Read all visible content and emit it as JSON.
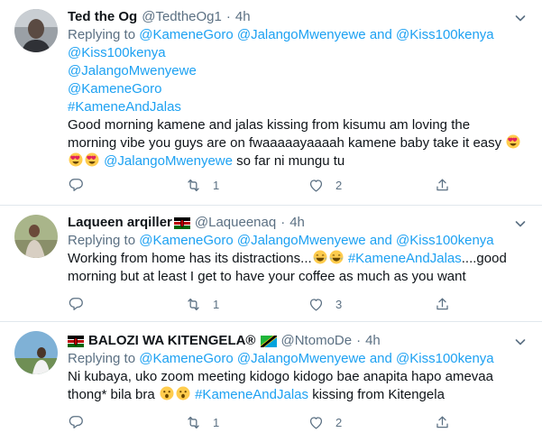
{
  "tweets": [
    {
      "name": "Ted the Og",
      "handle": "@TedtheOg1",
      "dot": "·",
      "time": "4h",
      "replying_prefix": "Replying to",
      "replying_handles": [
        "@KameneGoro",
        "@JalangoMwenyewe"
      ],
      "and_word": "and",
      "replying_last": "@Kiss100kenya",
      "tags": [
        "@Kiss100kenya",
        "@JalangoMwenyewe",
        "@KameneGoro",
        "#KameneAndJalas"
      ],
      "body_line1": "Good morning kamene and jalas kissing from kisumu  am loving the",
      "body_line2": "morning vibe  you guys are on fwaaaaayaaaah kamene baby take it easy",
      "body_line3_mention": "@JalangoMwenyewe",
      "body_line3_rest": "so far ni mungu tu",
      "retweets": "1",
      "likes": "2"
    },
    {
      "name": "Laqueen arqiller",
      "handle": "@Laqueenaq",
      "dot": "·",
      "time": "4h",
      "replying_prefix": "Replying to",
      "replying_handles": [
        "@KameneGoro",
        "@JalangoMwenyewe"
      ],
      "and_word": "and",
      "replying_last": "@Kiss100kenya",
      "body_line1_start": "Working from home has its distractions...",
      "body_line1_tag": "#KameneAndJalas",
      "body_line1_end": "....good",
      "body_line2": "morning but at least I get to have your coffee as much as you want",
      "retweets": "1",
      "likes": "3"
    },
    {
      "name": "BALOZI WA KITENGELA®",
      "handle": "@NtomoDe",
      "dot": "·",
      "time": "4h",
      "replying_prefix": "Replying to",
      "replying_handles": [
        "@KameneGoro",
        "@JalangoMwenyewe"
      ],
      "and_word": "and",
      "replying_last": "@Kiss100kenya",
      "body_line1": "Ni kubaya, uko zoom meeting kidogo kidogo bae anapita hapo amevaa",
      "body_line2_start": "thong* bila bra",
      "body_line2_tag": "#KameneAndJalas",
      "body_line2_end": "kissing from Kitengela",
      "retweets": "1",
      "likes": "2"
    }
  ],
  "colors": {
    "link": "#1da1f2",
    "muted": "#5b7083",
    "divider": "#e1e8ed"
  }
}
